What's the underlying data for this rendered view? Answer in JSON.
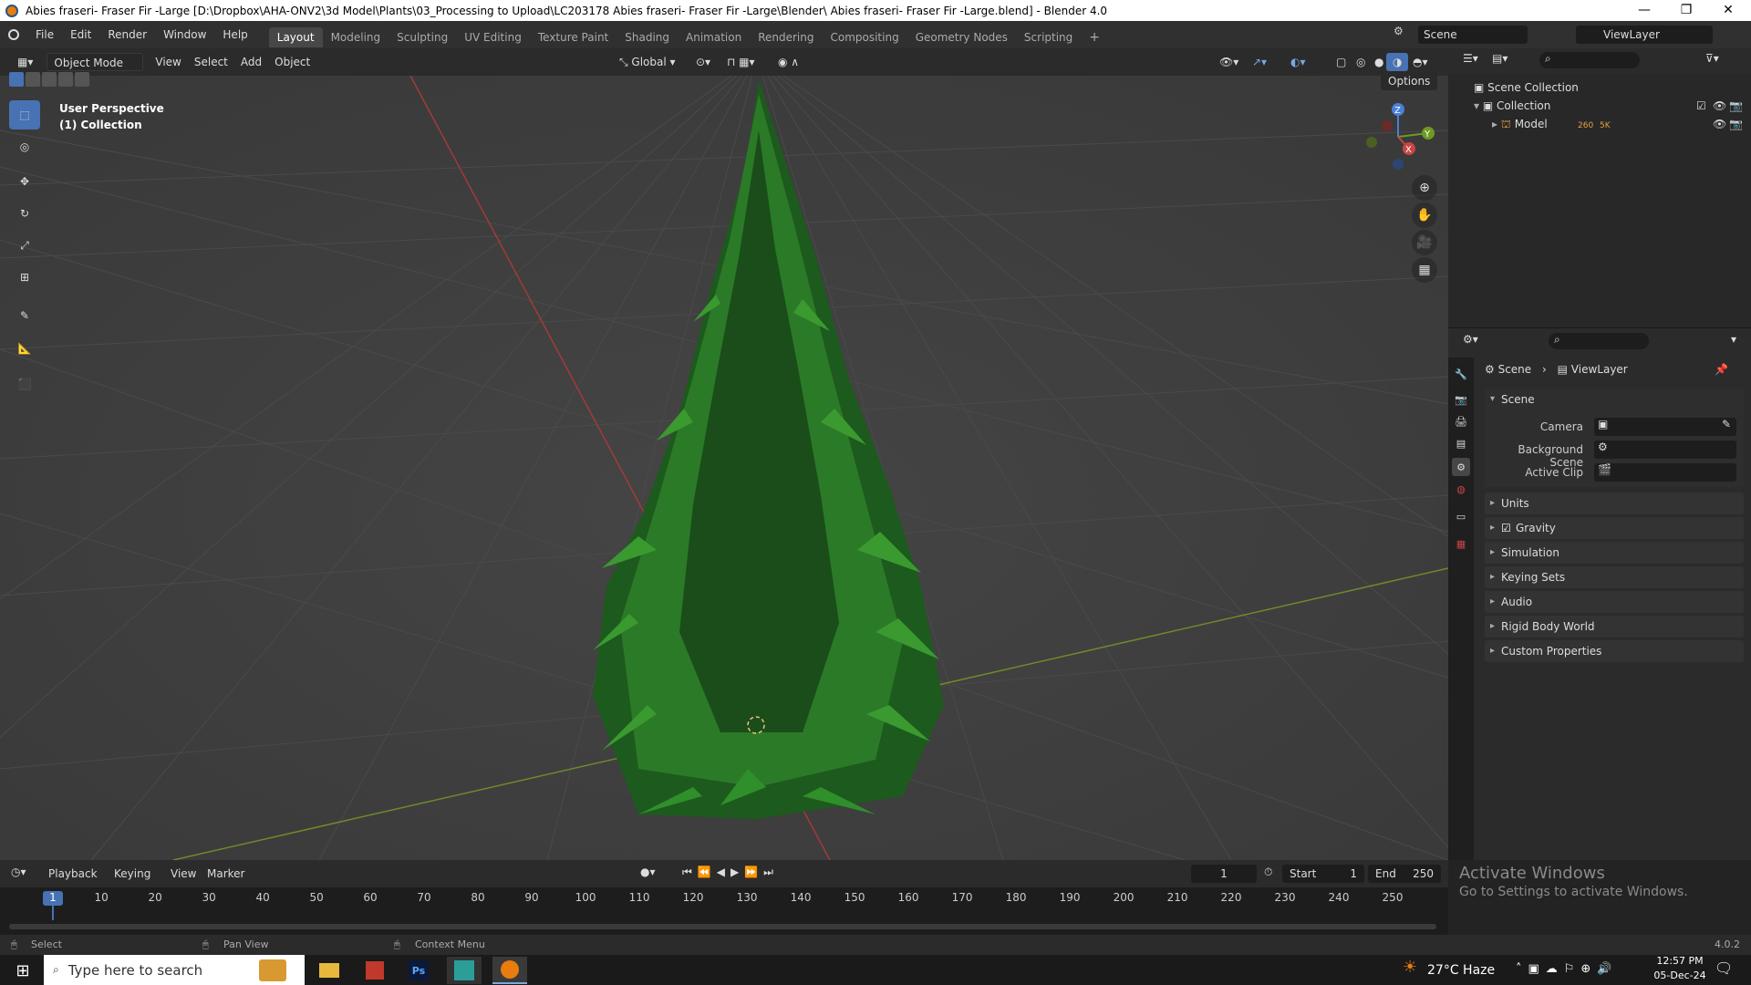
{
  "window": {
    "title": "Abies fraseri- Fraser Fir -Large [D:\\Dropbox\\AHA-ONV2\\3d Model\\Plants\\03_Processing to Upload\\LC203178 Abies fraseri- Fraser Fir -Large\\Blender\\ Abies fraseri- Fraser Fir -Large.blend] - Blender 4.0",
    "controls": [
      "—",
      "❐",
      "✕"
    ]
  },
  "topbar": {
    "menus": [
      "File",
      "Edit",
      "Render",
      "Window",
      "Help"
    ],
    "workspaces": [
      "Layout",
      "Modeling",
      "Sculpting",
      "UV Editing",
      "Texture Paint",
      "Shading",
      "Animation",
      "Rendering",
      "Compositing",
      "Geometry Nodes",
      "Scripting"
    ],
    "active_workspace": "Layout",
    "add_workspace": "+",
    "scene": "Scene",
    "view_layer": "ViewLayer"
  },
  "viewport_header": {
    "mode": "Object Mode",
    "menus": [
      "View",
      "Select",
      "Add",
      "Object"
    ],
    "orientation": "Global"
  },
  "viewport": {
    "overlay_line1": "User Perspective",
    "overlay_line2": "(1) Collection",
    "options_label": "Options",
    "gizmo": {
      "x": "X",
      "y": "Y",
      "z": "Z"
    }
  },
  "outliner": {
    "scene_collection": "Scene Collection",
    "collection": "Collection",
    "model": "Model",
    "model_badges": [
      "260",
      "5K"
    ]
  },
  "properties": {
    "breadcrumb_scene": "Scene",
    "breadcrumb_viewlayer": "ViewLayer",
    "scene_panel": "Scene",
    "camera_label": "Camera",
    "background_scene_label": "Background Scene",
    "active_clip_label": "Active Clip",
    "panels": [
      "Units",
      "Gravity",
      "Simulation",
      "Keying Sets",
      "Audio",
      "Rigid Body World",
      "Custom Properties"
    ]
  },
  "timeline": {
    "menus": [
      "Playback",
      "Keying",
      "View",
      "Marker"
    ],
    "current_frame": "1",
    "start_label": "Start",
    "start": "1",
    "end_label": "End",
    "end": "250",
    "ticks": [
      "1",
      "10",
      "20",
      "30",
      "40",
      "50",
      "60",
      "70",
      "80",
      "90",
      "100",
      "110",
      "120",
      "130",
      "140",
      "150",
      "160",
      "170",
      "180",
      "190",
      "200",
      "210",
      "220",
      "230",
      "240",
      "250"
    ]
  },
  "watermark": {
    "title": "Activate Windows",
    "subtitle": "Go to Settings to activate Windows."
  },
  "statusbar": {
    "select": "Select",
    "pan": "Pan View",
    "context": "Context Menu",
    "version": "4.0.2"
  },
  "taskbar": {
    "search_placeholder": "Type here to search",
    "weather": "27°C  Haze",
    "time": "12:57 PM",
    "date": "05-Dec-24"
  }
}
